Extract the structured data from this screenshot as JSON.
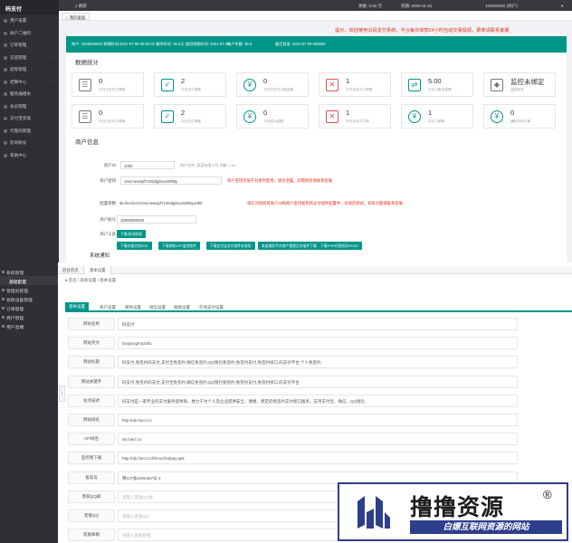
{
  "top": {
    "brand": "码支付",
    "sidebar": [
      {
        "label": "用户设置",
        "arrow": "‹"
      },
      {
        "label": "商户二维码",
        "arrow": "‹"
      },
      {
        "label": "订单管理",
        "arrow": "‹"
      },
      {
        "label": "充值管理",
        "arrow": "‹"
      },
      {
        "label": "提现管理",
        "arrow": "‹"
      },
      {
        "label": "结算中心",
        "arrow": "‹"
      },
      {
        "label": "服务器相关",
        "arrow": "‹"
      },
      {
        "label": "会员管理",
        "arrow": "‹"
      },
      {
        "label": "支付宝充值",
        "arrow": "‹"
      },
      {
        "label": "代理商管理",
        "arrow": "‹"
      },
      {
        "label": "轮询账号",
        "arrow": "‹"
      },
      {
        "label": "帮助中心",
        "arrow": "‹"
      }
    ],
    "header": {
      "menu": "≡ 刷新",
      "date": "余额: 0.00 元",
      "code": "到期: 0000-01-01",
      "account": "100000000 (商户)",
      "caret": "▾"
    },
    "tab": "○ 我的桌面",
    "warning": "提示，欢迎使用云码支付系统，平台每日收款24小时自动交易提现，费率请联系客服",
    "notice": {
      "left": "商户: 1000000000  到期时间:2021-07-09 00:00:01  剩余时间: 36.5天  使用到期时间: 2021-07-09",
      "mid": "商户余额: 36.5",
      "right": "最后登录: 2021-07-09 000000"
    },
    "stats_title": "数据统计",
    "stats_row1": [
      {
        "icon": "☰",
        "value": "0",
        "label": "今日已支付订单数"
      },
      {
        "icon": "✓",
        "value": "2",
        "label": "今日总订单数"
      },
      {
        "icon": "¥",
        "value": "0",
        "label": "今日已支付订单金额"
      },
      {
        "icon": "✕",
        "value": "1",
        "label": "今日未支付订单数"
      },
      {
        "icon": "⇄",
        "value": "5.00",
        "label": "今日订单总金额"
      },
      {
        "icon": "◆",
        "value": "监控未绑定",
        "label": "监控状态"
      }
    ],
    "stats_row2": [
      {
        "icon": "☰",
        "value": "0",
        "label": "今日已支付订单数"
      },
      {
        "icon": "✓",
        "value": "2",
        "label": "今日总订单数"
      },
      {
        "icon": "¥",
        "value": "0",
        "label": "今日成功金额"
      },
      {
        "icon": "✕",
        "value": "1",
        "label": "今日未支付订单"
      },
      {
        "icon": "¥",
        "value": "1",
        "label": "今日订单数"
      },
      {
        "icon": "¥",
        "value": "0",
        "label": "通知失败订单"
      }
    ],
    "merchant_title": "商户信息",
    "merchant": {
      "id_label": "商户ID",
      "id_value": "1000",
      "id_note": "商户名称: 某某有限公司  余额: 1.00",
      "key_label": "商户密钥",
      "key_value": "14ecnew4pf7zm0dg0xcx0006y",
      "key_warning": "商户密钥仅限于对接时使用，请勿泄露，如需修改请联系客服",
      "ver_label": "配置参数",
      "ver_value": "de.hiecl1crz14ecnew4pf7zm0dg0xcx0006y1000",
      "ver_warning": "请在对接前将商户ID和商户密钥复制到支付插件配置中，对接后测试，如有问题请联系客服",
      "acct_label": "商户账号",
      "acct_value": "15000000000",
      "tools_label": "商户工具",
      "tools_btn": "下载/测试收银",
      "buttons": [
        "下载对接文档SDK",
        "下载收款APP监控软件",
        "下载支付宝支付插件安装包",
        "某某服务平台商户管理后台插件下载",
        "下载PHP对接测试DEMO"
      ]
    },
    "notice2": "系统通知"
  },
  "bottom": {
    "sidebar": [
      {
        "label": "系统管理",
        "type": "group"
      },
      {
        "label": "基础配置",
        "type": "sub"
      },
      {
        "label": "管理员管理",
        "type": "group"
      },
      {
        "label": "收款设备管理",
        "type": "group"
      },
      {
        "label": "订单管理",
        "type": "group"
      },
      {
        "label": "商户管理",
        "type": "group"
      },
      {
        "label": "用户后端",
        "type": "group"
      }
    ],
    "tabs": [
      "后台首页",
      "基本设置"
    ],
    "breadcrumb": "♠ 首页 / 系统设置 / 基本设置",
    "form_tabs": [
      "基本设置",
      "商户设置",
      "邮件设置",
      "短信设置",
      "收款设置",
      "在线支付设置"
    ],
    "fields": [
      {
        "label": "网站名称",
        "value": "码支付",
        "placeholder": false
      },
      {
        "label": "网站英文",
        "value": "longlongmazhifu",
        "placeholder": false
      },
      {
        "label": "网站标题",
        "value": "码支付,免签约码支付,支付宝免签约,微信免签约,QQ钱包免签约,免签约支付,免签约接口,码支付平台,个人免签约",
        "placeholder": false
      },
      {
        "label": "网站关键字",
        "value": "码支付,免签约码支付,支付宝免签约,微信免签约,QQ钱包免签约,免签约支付,免签约接口,码支付平台",
        "placeholder": false
      },
      {
        "label": "站点描述",
        "value": "码支付是一家专业的支付服务提供商，致力于为个人及企业提供安全、便捷、稳定的免签约支付接口服务，支持支付宝、微信、QQ钱包",
        "placeholder": false
      },
      {
        "label": "网站域名",
        "value": "http://de.hiecl.cn",
        "placeholder": false
      },
      {
        "label": "API域名",
        "value": "de.hiecl.cn",
        "placeholder": false
      },
      {
        "label": "监控端下载",
        "value": "http://de.hiecl.cn/hlicsc/livdpay.apk",
        "placeholder": false
      },
      {
        "label": "备案号",
        "value": "豫ICP备2000457号-3",
        "placeholder": false
      },
      {
        "label": "客服QQ群",
        "value": "请输入客服QQ群",
        "placeholder": true
      },
      {
        "label": "客服QQ",
        "value": "请输入客服QQ",
        "placeholder": true
      },
      {
        "label": "客服邮箱",
        "value": "请输入客服邮箱",
        "placeholder": true
      }
    ],
    "handle": "‹"
  },
  "watermark": {
    "title": "撸撸资源",
    "reg": "®",
    "subtitle": "白嫖互联网资源的网站"
  },
  "colors": {
    "accent": "#009688",
    "sidebar": "#2f3035",
    "warn": "#e0301e",
    "watermark": "#2d3e8a"
  }
}
